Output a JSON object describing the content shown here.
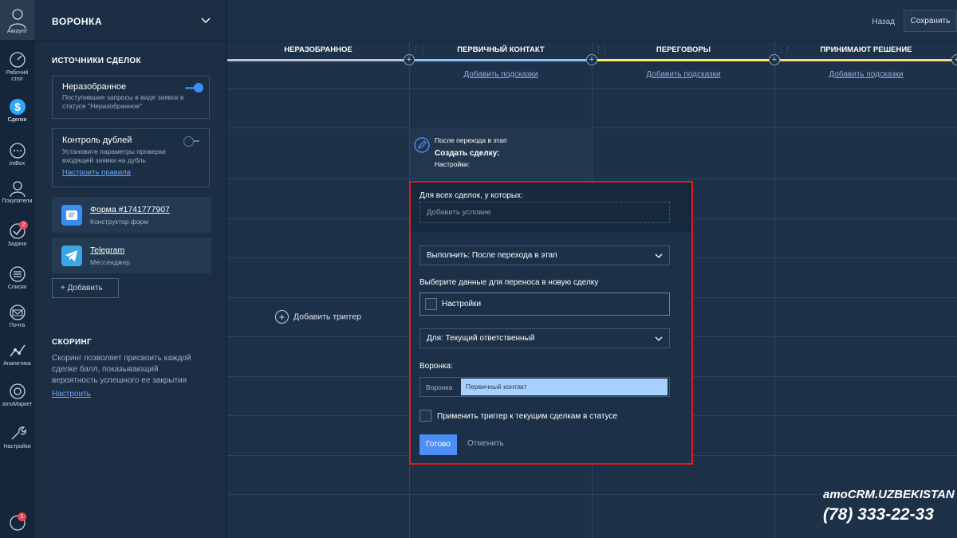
{
  "rail": {
    "account": "Аккаунт",
    "items": [
      {
        "label": "Рабочий стол",
        "icon": "dashboard-icon"
      },
      {
        "label": "Сделки",
        "icon": "deals-icon"
      },
      {
        "label": "imBox",
        "icon": "chat-icon"
      },
      {
        "label": "Покупатели",
        "icon": "customers-icon"
      },
      {
        "label": "Задачи",
        "icon": "tasks-icon",
        "badge": "2"
      },
      {
        "label": "Списки",
        "icon": "lists-icon"
      },
      {
        "label": "Почта",
        "icon": "mail-icon"
      },
      {
        "label": "Аналитика",
        "icon": "analytics-icon"
      },
      {
        "label": "amoМаркет",
        "icon": "market-icon"
      },
      {
        "label": "Настройки",
        "icon": "settings-icon"
      }
    ],
    "bottom_badge": "1"
  },
  "panel": {
    "title": "ВОРОНКА",
    "sources_title": "ИСТОЧНИКИ СДЕЛОК",
    "unsorted": {
      "title": "Неразобранное",
      "desc": "Поступившие запросы в виде заявок в статусе \"Неразобранное\""
    },
    "duplicates": {
      "title": "Контроль дублей",
      "desc": "Установите параметры проверки входящей заявки на дубль",
      "link": "Настроить правила"
    },
    "form": {
      "title": "Форма #1741777907",
      "sub": "Конструктор форм"
    },
    "telegram": {
      "title": "Telegram",
      "sub": "Мессенджер"
    },
    "add_label": "+ Добавить",
    "scoring_title": "СКОРИНГ",
    "scoring_text": "Скоринг позволяет присвоить каждой сделке балл, показывающий вероятность успешного ее закрытия",
    "scoring_link": "Настроить"
  },
  "topbar": {
    "back": "Назад",
    "save": "Сохранить"
  },
  "columns": [
    {
      "name": "НЕРАЗОБРАННОЕ",
      "color": "#b9c3cf",
      "hints": ""
    },
    {
      "name": "ПЕРВИЧНЫЙ КОНТАКТ",
      "color": "#8cc4ff",
      "hints": "Добавить подсказки"
    },
    {
      "name": "ПЕРЕГОВОРЫ",
      "color": "#ffee60",
      "hints": "Добавить подсказки"
    },
    {
      "name": "ПРИНИМАЮТ РЕШЕНИЕ",
      "color": "#ffd880",
      "hints": "Добавить подсказки"
    }
  ],
  "trigger_card": {
    "line1": "После перехода в этап",
    "line2": "Создать сделку:",
    "line3": "Настройки:"
  },
  "add_trigger": "Добавить триггер",
  "modal": {
    "cond_label": "Для всех сделок, у которых:",
    "cond_placeholder": "Добавить условие",
    "execute": "Выполнить: После перехода в этап",
    "transfer_label": "Выберите данные для переноса в новую сделку",
    "settings_field": "Настройки",
    "for_select": "Для: Текущий ответственный",
    "funnel_label": "Воронка:",
    "funnel_inner_label": "Воронка",
    "funnel_value": "Первичный контакт",
    "apply_label": "Применить триггер к текущим сделкам в статусе",
    "done": "Готово",
    "cancel": "Отменить"
  },
  "watermark": {
    "brand": "amoCRM.UZBEKISTAN",
    "phone": "(78) 333-22-33"
  }
}
